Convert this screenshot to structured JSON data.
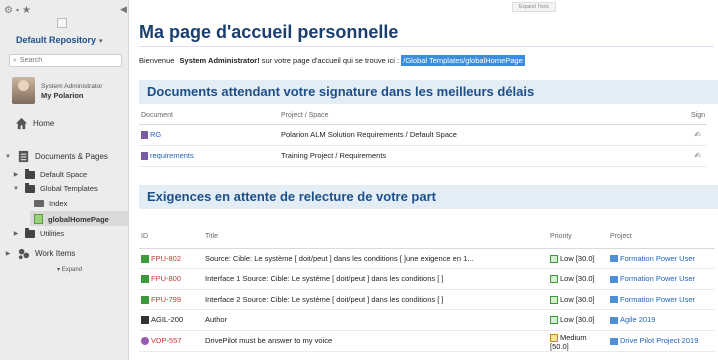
{
  "sidebar": {
    "repo_label": "Default Repository",
    "search_placeholder": "Search",
    "user": {
      "name": "System Administrator",
      "link": "My Polarion"
    },
    "home": "Home",
    "docs_pages": "Documents & Pages",
    "default_space": "Default Space",
    "global_templates": "Global Templates",
    "index": "Index",
    "global_home_page": "globalHomePage",
    "utilities": "Utilities",
    "work_items": "Work Items",
    "expand": "Expand"
  },
  "main": {
    "expand_tools": "Expand Tools",
    "title": "Ma page d'accueil personnelle",
    "welcome_prefix": "Bienvenue",
    "welcome_user": "System Administrator!",
    "welcome_mid": "sur votre page d'accueil qui se trouve ici :",
    "welcome_path": "/Global Templates/globalHomePage",
    "section1": {
      "title": "Documents attendant votre signature dans les meilleurs délais",
      "headers": [
        "Document",
        "Project / Space",
        "Sign"
      ],
      "rows": [
        {
          "doc": "RG",
          "project": "Polarion ALM Solution Requirements / Default Space"
        },
        {
          "doc": "requirements",
          "project": "Training Project / Requirements"
        }
      ]
    },
    "section2": {
      "title": "Exigences en attente de relecture de votre part",
      "headers": [
        "ID",
        "Title",
        "Priority",
        "Project"
      ],
      "rows": [
        {
          "id": "FPU-802",
          "title": "Source: Cible: Le système [ doit/peut ] dans les conditions [ ]une exigence en 1...",
          "priority": "Low [30.0]",
          "project": "Formation Power User"
        },
        {
          "id": "FPU-800",
          "title": "Interface 1 Source: Cible: Le système [ doit/peut ] dans les conditions [ ]",
          "priority": "Low [30.0]",
          "project": "Formation Power User"
        },
        {
          "id": "FPU-799",
          "title": "Interface 2 Source: Cible: Le système [ doit/peut ] dans les conditions [ ]",
          "priority": "Low [30.0]",
          "project": "Formation Power User"
        },
        {
          "id": "AGIL-200",
          "title": "Author",
          "priority": "Low [30.0]",
          "project": "Agile 2019"
        },
        {
          "id": "VDP-557",
          "title": "DrivePilot must be answer to my voice",
          "priority_line1": "Medium",
          "priority_line2": "[50.0]",
          "project": "Drive Pilot Project 2019"
        }
      ]
    }
  }
}
